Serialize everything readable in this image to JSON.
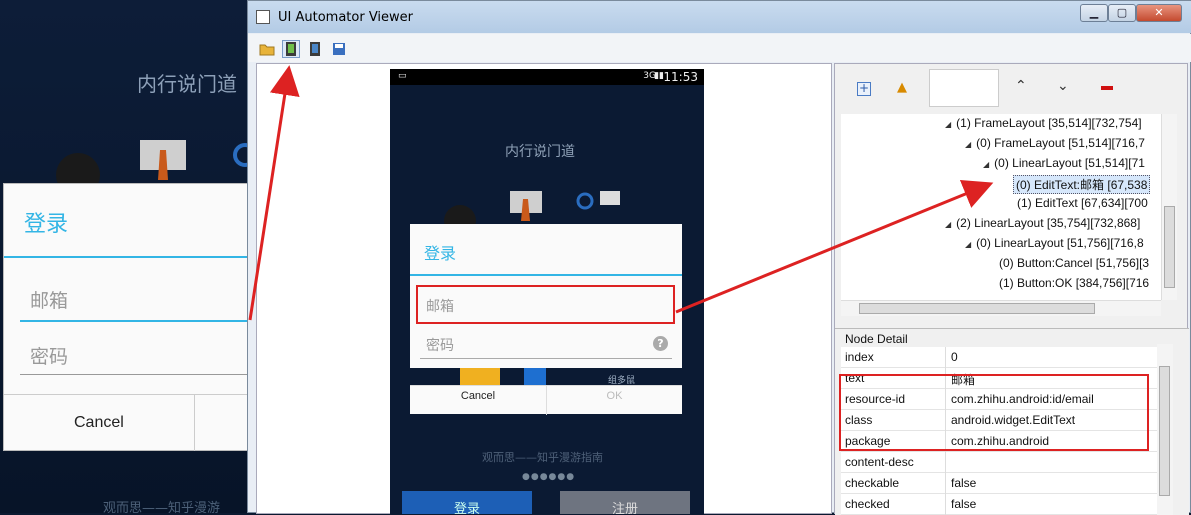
{
  "background_app": {
    "title": "内行说门道",
    "dialog": {
      "title": "登录",
      "email_placeholder": "邮箱",
      "password_placeholder": "密码",
      "cancel_label": "Cancel"
    },
    "footer": "观而思——知乎漫游"
  },
  "window": {
    "title": "UI Automator Viewer",
    "minimize": "▁",
    "maximize": "▢",
    "close": "✕"
  },
  "toolbar": {
    "icons": [
      "open-folder-icon",
      "device-screenshot-icon",
      "device-screenshot-compressed-icon",
      "save-icon"
    ]
  },
  "device": {
    "status_time": "11:53",
    "status_signal": "3G",
    "title": "内行说门道",
    "dialog": {
      "title": "登录",
      "email_placeholder": "邮箱",
      "password_placeholder": "密码",
      "cancel_label": "Cancel",
      "ok_label": "OK"
    },
    "footer": "观而思——知乎漫游指南",
    "login_button": "登录",
    "register_button": "注册"
  },
  "tree": {
    "nodes": [
      {
        "label": "(1) FrameLayout [35,514][732,754]",
        "depth": 0
      },
      {
        "label": "(0) FrameLayout [51,514][716,7",
        "depth": 1
      },
      {
        "label": "(0) LinearLayout [51,514][71",
        "depth": 2
      },
      {
        "label": "(0) EditText:邮箱 [67,538",
        "depth": 3,
        "selected": true
      },
      {
        "label": "(1) EditText [67,634][700",
        "depth": 3
      },
      {
        "label": "(2) LinearLayout [35,754][732,868]",
        "depth": 0
      },
      {
        "label": "(0) LinearLayout [51,756][716,8",
        "depth": 1
      },
      {
        "label": "(0) Button:Cancel [51,756][3",
        "depth": 2
      },
      {
        "label": "(1) Button:OK [384,756][716",
        "depth": 2
      }
    ]
  },
  "node_detail": {
    "header": "Node Detail",
    "rows": [
      {
        "key": "index",
        "value": "0"
      },
      {
        "key": "text",
        "value": "邮箱"
      },
      {
        "key": "resource-id",
        "value": "com.zhihu.android:id/email"
      },
      {
        "key": "class",
        "value": "android.widget.EditText"
      },
      {
        "key": "package",
        "value": "com.zhihu.android"
      },
      {
        "key": "content-desc",
        "value": ""
      },
      {
        "key": "checkable",
        "value": "false"
      },
      {
        "key": "checked",
        "value": "false"
      }
    ]
  },
  "colors": {
    "accent": "#33b5e5",
    "annotation": "#dd2222"
  }
}
